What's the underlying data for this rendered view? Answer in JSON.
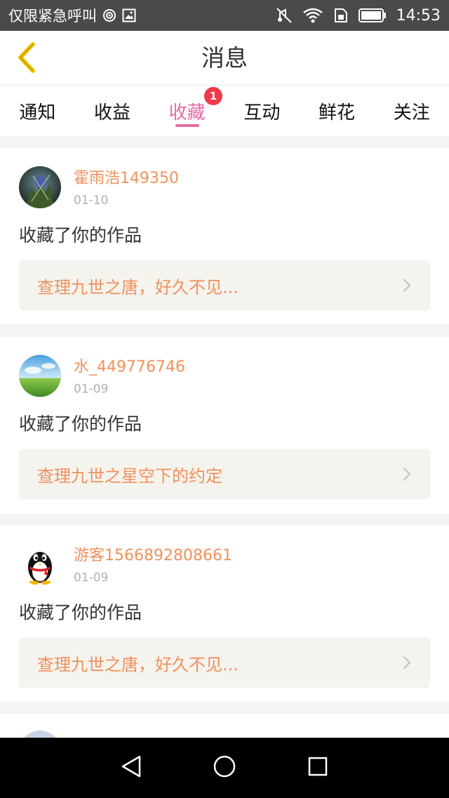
{
  "status_bar": {
    "carrier_text": "仅限紧急呼叫",
    "time": "14:53",
    "icons": [
      "hotspot-icon",
      "image-icon",
      "mute-icon",
      "wifi-icon",
      "sim-icon",
      "battery-icon"
    ]
  },
  "header": {
    "title": "消息",
    "back_icon": "chevron-left-icon"
  },
  "tabs": [
    {
      "label": "通知"
    },
    {
      "label": "收益"
    },
    {
      "label": "收藏",
      "active": true,
      "badge": "1"
    },
    {
      "label": "互动"
    },
    {
      "label": "鲜花"
    },
    {
      "label": "关注"
    }
  ],
  "messages": [
    {
      "username": "霍雨浩149350",
      "date": "01-10",
      "text": "收藏了你的作品",
      "work_title": "查理九世之唐，好久不见...",
      "avatar": "anime-avatar"
    },
    {
      "username": "水_449776746",
      "date": "01-09",
      "text": "收藏了你的作品",
      "work_title": "查理九世之星空下的约定",
      "avatar": "landscape-avatar"
    },
    {
      "username": "游客1566892808661",
      "date": "01-09",
      "text": "收藏了你的作品",
      "work_title": "查理九世之唐，好久不见...",
      "avatar": "penguin-avatar"
    }
  ],
  "colors": {
    "accent_pink": "#e86aa4",
    "username_orange": "#f0915c",
    "badge_red": "#f0394a",
    "back_icon_yellow": "#f2c200"
  }
}
